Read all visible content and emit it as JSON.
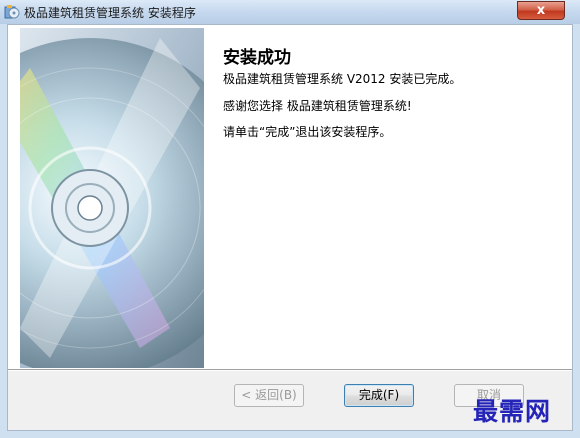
{
  "window": {
    "title": "极品建筑租赁管理系统 安装程序",
    "close_label": "x"
  },
  "content": {
    "heading": "安装成功",
    "line1": "极品建筑租赁管理系统 V2012 安装已完成。",
    "line2": "感谢您选择 极品建筑租赁管理系统!",
    "line3": "请单击“完成”退出该安装程序。"
  },
  "buttons": {
    "back": "< 返回(B)",
    "finish": "完成(F)",
    "cancel": "取消"
  },
  "watermark": "最需网",
  "icons": {
    "title": "installer-app-icon",
    "sidebar": "cd-disc-image"
  },
  "colors": {
    "titlebar": "#c5d8ee",
    "close_button": "#c0391f",
    "watermark": "#2424b8"
  }
}
